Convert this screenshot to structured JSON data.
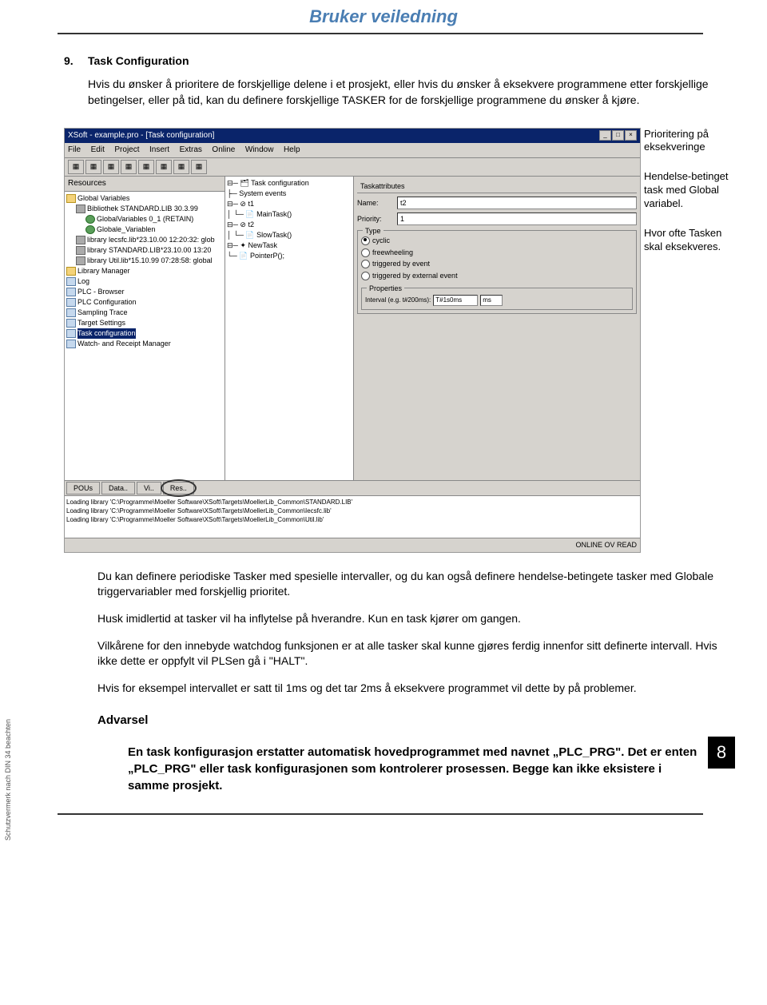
{
  "page": {
    "title": "Bruker veiledning",
    "section_number": "9.",
    "section_title": "Task Configuration",
    "intro": "Hvis du ønsker å prioritere de forskjellige delene i et prosjekt, eller hvis du ønsker å eksekvere programmene etter forskjellige betingelser, eller på tid, kan du definere forskjellige TASKER for de forskjellige programmene du ønsker å kjøre.",
    "p2": "Du kan definere periodiske Tasker med spesielle intervaller, og du kan også definere hendelse-betingete tasker med Globale triggervariabler med forskjellig prioritet.",
    "p3": "Husk imidlertid at tasker vil ha inflytelse på hverandre. Kun en task kjører om gangen.",
    "p4": "Vilkårene for den innebyde watchdog funksjonen er at alle tasker skal kunne gjøres ferdig innenfor sitt definerte intervall. Hvis ikke dette er oppfylt vil PLSen gå i \"HALT\".",
    "p5": "Hvis for eksempel intervallet er satt til 1ms og det tar 2ms å eksekvere programmet vil dette by på problemer.",
    "warning_heading": "Advarsel",
    "warning_body": "En task konfigurasjon erstatter automatisk hovedprogrammet med navnet „PLC_PRG\". Det er enten „PLC_PRG\" eller task konfigurasjonen som kontrolerer prosessen. Begge kan ikke eksistere i samme prosjekt.",
    "page_number": "8",
    "side_note": "Schutzvermerk nach DIN 34 beachten"
  },
  "callouts": {
    "c1": "Prioritering på eksekveringe",
    "c2": "Hendelse-betinget task med Global variabel.",
    "c3": "Hvor ofte Tasken skal eksekveres."
  },
  "ide": {
    "window_title": "XSoft - example.pro - [Task configuration]",
    "menu": [
      "File",
      "Edit",
      "Project",
      "Insert",
      "Extras",
      "Online",
      "Window",
      "Help"
    ],
    "left_panel_header": "Resources",
    "left_tree": [
      {
        "t": "Global Variables",
        "indent": 0,
        "icon": "folder"
      },
      {
        "t": "Bibliothek STANDARD.LIB 30.3.99",
        "indent": 1,
        "icon": "book"
      },
      {
        "t": "GlobalVariables 0_1 (RETAIN)",
        "indent": 2,
        "icon": "globe"
      },
      {
        "t": "Globale_Variablen",
        "indent": 2,
        "icon": "globe"
      },
      {
        "t": "library lecsfc.lib*23.10.00 12:20:32: glob",
        "indent": 1,
        "icon": "book"
      },
      {
        "t": "library STANDARD.LIB*23.10.00 13:20",
        "indent": 1,
        "icon": "book"
      },
      {
        "t": "library Util.lib*15.10.99 07:28:58: global",
        "indent": 1,
        "icon": "book"
      },
      {
        "t": "Library Manager",
        "indent": 0,
        "icon": "folder"
      },
      {
        "t": "Log",
        "indent": 0,
        "icon": "box"
      },
      {
        "t": "PLC - Browser",
        "indent": 0,
        "icon": "box"
      },
      {
        "t": "PLC Configuration",
        "indent": 0,
        "icon": "box"
      },
      {
        "t": "Sampling Trace",
        "indent": 0,
        "icon": "box"
      },
      {
        "t": "Target Settings",
        "indent": 0,
        "icon": "box"
      },
      {
        "t": "Task configuration",
        "indent": 0,
        "icon": "box",
        "selected": true
      },
      {
        "t": "Watch- and Receipt Manager",
        "indent": 0,
        "icon": "box"
      }
    ],
    "left_tabs": [
      "POUs",
      "Data..",
      "Vi..",
      "Res.."
    ],
    "left_tabs_circled": 3,
    "mid_tree": [
      "⊟─ 🗂 Task configuration",
      "    ├─ System events",
      "    ⊟─ ⊘ t1",
      "    │   └─ 📄 MainTask()",
      "    ⊟─ ⊘ t2",
      "    │   └─ 📄 SlowTask()",
      "    ⊟─ ✦ NewTask",
      "        └─ 📄 PointerP();"
    ],
    "task_tab": "Taskattributes",
    "fields": {
      "name_label": "Name:",
      "name_value": "t2",
      "prio_label": "Priority:",
      "prio_value": "1"
    },
    "type_group": "Type",
    "type_options": [
      {
        "label": "cyclic",
        "checked": true
      },
      {
        "label": "freewheeling",
        "checked": false
      },
      {
        "label": "triggered by event",
        "checked": false
      },
      {
        "label": "triggered by external event",
        "checked": false
      }
    ],
    "props_label": "Properties",
    "interval_label": "Interval (e.g. t#200ms):",
    "interval_value": "T#1s0ms",
    "interval_unit": "ms",
    "log_lines": [
      "Loading library 'C:\\Programme\\Moeller Software\\XSoft\\Targets\\MoellerLib_Common\\STANDARD.LIB'",
      "Loading library 'C:\\Programme\\Moeller Software\\XSoft\\Targets\\MoellerLib_Common\\Iecsfc.lib'",
      "Loading library 'C:\\Programme\\Moeller Software\\XSoft\\Targets\\MoellerLib_Common\\Util.lib'"
    ],
    "status": "ONLINE  OV  READ"
  }
}
